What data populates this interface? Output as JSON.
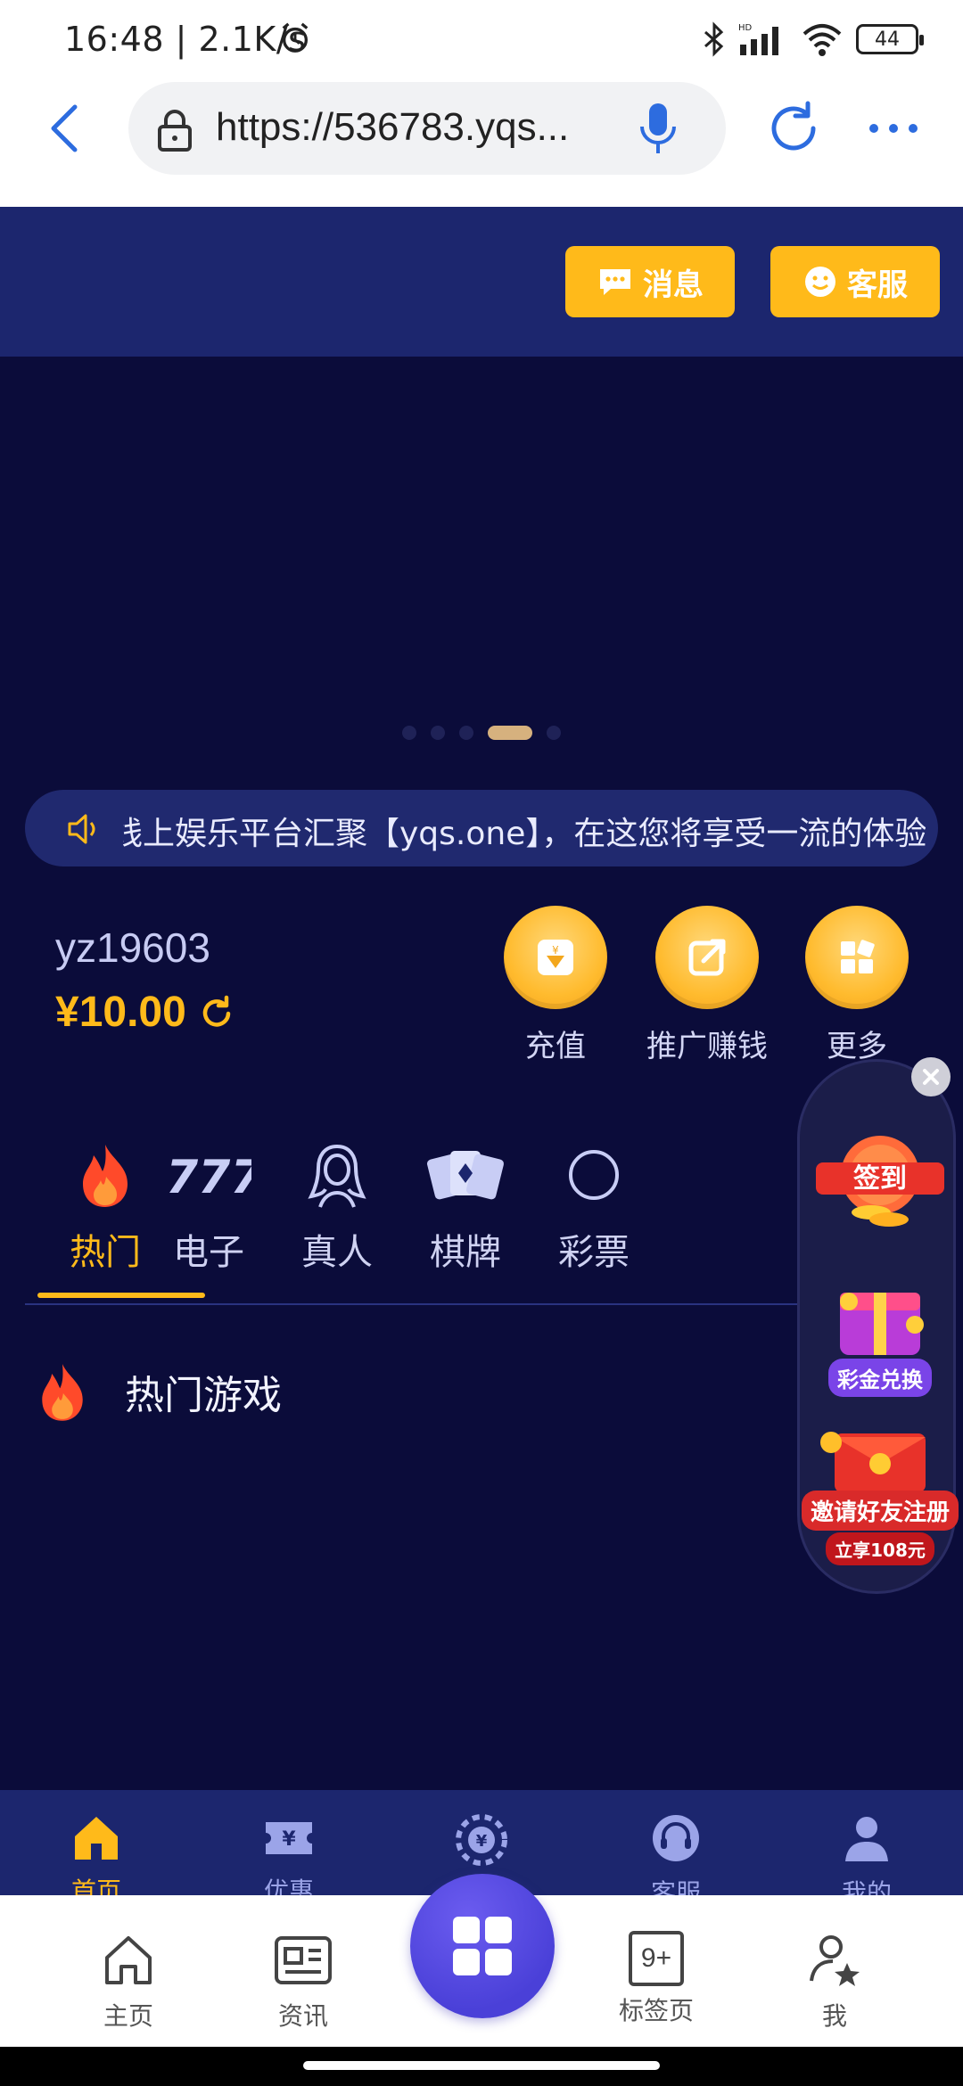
{
  "status_bar": {
    "time": "16:48 | 2.1K/s",
    "battery": "44"
  },
  "browser": {
    "url": "https://536783.yqs...",
    "tab_count": "9+"
  },
  "header": {
    "message_label": "消息",
    "service_label": "客服"
  },
  "banner": {
    "dot_count": 5,
    "active_dot": 4
  },
  "marquee": {
    "text": "线上娱乐平台汇聚【yqs.one】，在这您将享受一流的体验"
  },
  "user": {
    "username": "yz19603",
    "balance": "¥10.00"
  },
  "quick_actions": [
    {
      "label": "充值",
      "icon": "deposit-icon"
    },
    {
      "label": "推广赚钱",
      "icon": "share-icon"
    },
    {
      "label": "更多",
      "icon": "grid-icon"
    }
  ],
  "categories": [
    {
      "label": "热门",
      "icon": "fire-icon",
      "active": true
    },
    {
      "label": "电子",
      "icon": "slot-777-icon",
      "active": false
    },
    {
      "label": "真人",
      "icon": "woman-icon",
      "active": false
    },
    {
      "label": "棋牌",
      "icon": "cards-icon",
      "active": false
    },
    {
      "label": "彩票",
      "icon": "lottery-icon",
      "active": false
    }
  ],
  "section": {
    "title": "热门游戏"
  },
  "promos": [
    {
      "label": "签到"
    },
    {
      "label": "彩金兑换"
    },
    {
      "label": "邀请好友注册",
      "sub": "立享108元"
    }
  ],
  "site_nav": [
    {
      "label": "首页",
      "icon": "home-icon",
      "active": true
    },
    {
      "label": "优惠",
      "icon": "coupon-icon",
      "active": false
    },
    {
      "label": "",
      "icon": "chip-icon",
      "active": false
    },
    {
      "label": "客服",
      "icon": "headset-icon",
      "active": false
    },
    {
      "label": "我的",
      "icon": "user-icon",
      "active": false
    }
  ],
  "browser_nav": [
    {
      "label": "主页",
      "icon": "home-outline-icon"
    },
    {
      "label": "资讯",
      "icon": "news-icon"
    },
    {
      "label": "标签页",
      "icon": "tabs-icon"
    },
    {
      "label": "我",
      "icon": "profile-star-icon"
    }
  ],
  "colors": {
    "accent": "#ffba1a",
    "bg": "#0b0c3a",
    "header": "#1c266e"
  }
}
